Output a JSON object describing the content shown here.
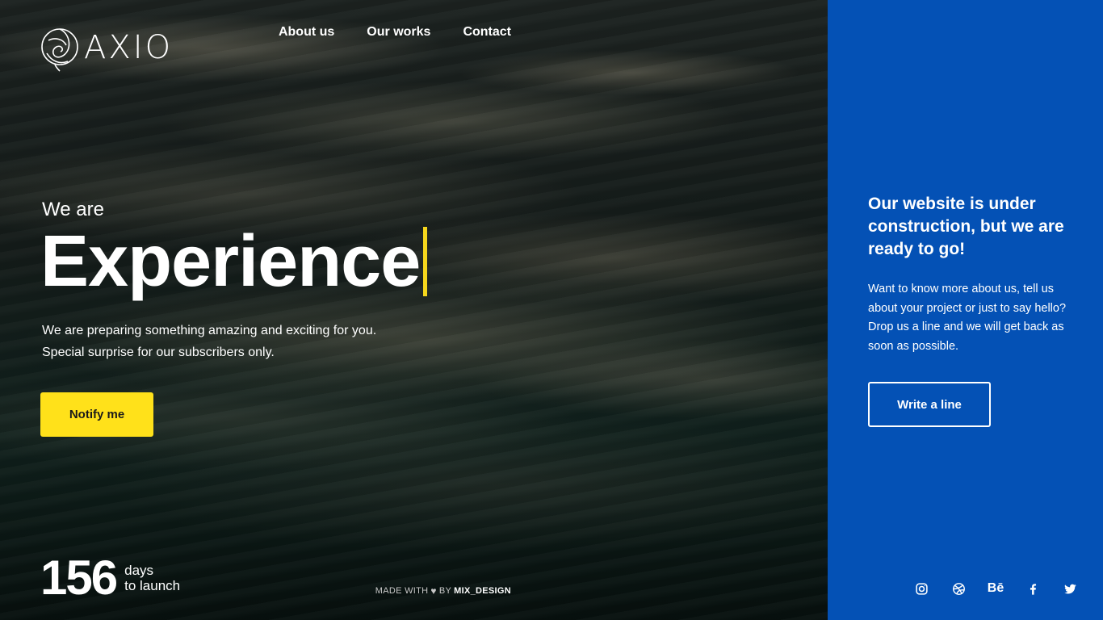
{
  "brand": {
    "logo_text": "AXIO"
  },
  "nav": {
    "items": [
      "About us",
      "Our works",
      "Contact"
    ]
  },
  "hero": {
    "pre_title": "We are",
    "headline": "Experience",
    "lead_line1": "We are preparing something amazing and exciting for you.",
    "lead_line2": "Special surprise for our subscribers only.",
    "notify_label": "Notify me"
  },
  "countdown": {
    "value": "156",
    "unit_line1": "days",
    "unit_line2": "to launch"
  },
  "credit": {
    "prefix": "MADE WITH",
    "by": "BY",
    "brand": "MIX_DESIGN"
  },
  "panel": {
    "title": "Our website is under construction, but we are ready to go!",
    "text": "Want to know more about us, tell us about your project or just to say hello? Drop us a line and we will get back as soon as possible.",
    "button_label": "Write a line"
  },
  "social": {
    "behance_label": "Bē",
    "icons": [
      "instagram-icon",
      "dribbble-icon",
      "behance-icon",
      "facebook-icon",
      "twitter-icon"
    ]
  },
  "colors": {
    "accent": "#ffe11a",
    "panel": "#0451b5",
    "cursor": "#f6d71c"
  }
}
